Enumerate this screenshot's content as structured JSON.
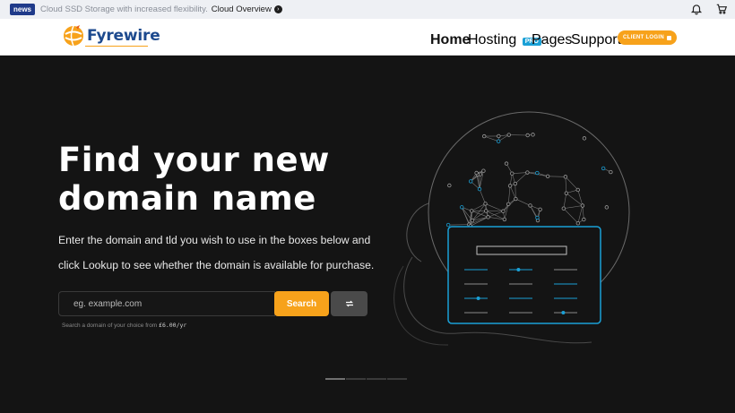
{
  "topbar": {
    "badge": "news",
    "text": "Cloud SSD Storage with increased flexibility.",
    "link": "Cloud Overview"
  },
  "nav": {
    "brand": "Fyrewire",
    "items": [
      {
        "label": "Home"
      },
      {
        "label": "Hosting",
        "badge": "PRO"
      },
      {
        "label": "Pages"
      },
      {
        "label": "Support"
      }
    ],
    "login": "CLIENT LOGIN"
  },
  "hero": {
    "title_line1": "Find your new",
    "title_line2": "domain name",
    "subtitle": "Enter the domain and tld you wish to use in the boxes below and click Lookup to see whether the domain is available for purchase.",
    "search": {
      "placeholder": "eg. example.com",
      "button": "Search",
      "hint": "Search a domain of your choice from",
      "price": "£6.00/yr"
    }
  },
  "colors": {
    "accent": "#f7a21b",
    "brand": "#1d4a8e",
    "cyan": "#1aa0d6"
  }
}
